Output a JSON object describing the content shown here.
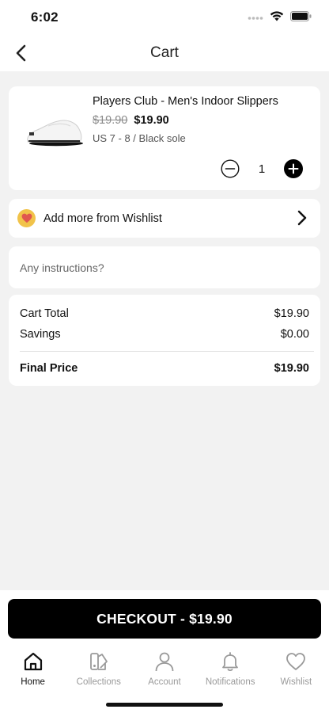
{
  "status": {
    "time": "6:02"
  },
  "header": {
    "title": "Cart"
  },
  "item": {
    "name": "Players Club - Men's Indoor Slippers",
    "old_price": "$19.90",
    "new_price": "$19.90",
    "variant": "US 7 - 8 / Black sole",
    "quantity": "1"
  },
  "wishlist": {
    "label": "Add more from Wishlist"
  },
  "instructions": {
    "placeholder": "Any instructions?"
  },
  "totals": {
    "cart_total_label": "Cart Total",
    "cart_total_value": "$19.90",
    "savings_label": "Savings",
    "savings_value": "$0.00",
    "final_label": "Final Price",
    "final_value": "$19.90"
  },
  "checkout": {
    "label": "CHECKOUT - $19.90"
  },
  "tabs": [
    {
      "label": "Home",
      "icon": "home-icon",
      "active": true
    },
    {
      "label": "Collections",
      "icon": "collections-icon",
      "active": false
    },
    {
      "label": "Account",
      "icon": "account-icon",
      "active": false
    },
    {
      "label": "Notifications",
      "icon": "bell-icon",
      "active": false
    },
    {
      "label": "Wishlist",
      "icon": "heart-icon",
      "active": false
    }
  ],
  "colors": {
    "accent": "#000000",
    "background": "#f2f2f2",
    "wishlist_badge": "#f1c34a",
    "heart": "#e0574f",
    "inactive": "#9a9a9a"
  }
}
